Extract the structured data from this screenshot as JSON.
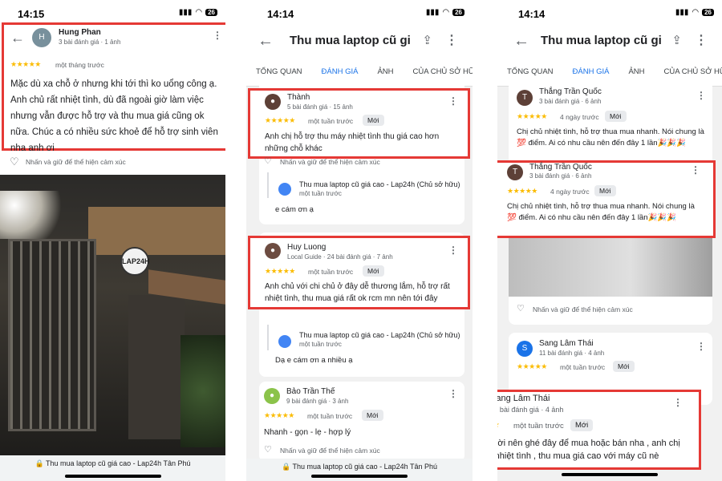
{
  "status": {
    "time_1": "14:15",
    "time_2": "14:14",
    "time_3": "14:14",
    "battery": "26"
  },
  "common": {
    "app_title": "Thu mua laptop cũ giá c...",
    "app_title_3": "Thu mua laptop cũ giá ...",
    "tabs": [
      "TỔNG QUAN",
      "ĐÁNH GIÁ",
      "ẢNH",
      "CỦA CHỦ SỞ HỮU"
    ],
    "react_hint": "Nhấn và giữ để thể hiện cảm xúc",
    "new_badge": "Mới",
    "owner_name": "Thu mua laptop cũ giá cao - Lap24h (Chủ sở hữu)",
    "owner_time": "một tuần trước",
    "stars": "★★★★★",
    "bottom_url": "Thu mua laptop cũ giá cao - Lap24h Tân Phú"
  },
  "phone1": {
    "reviewer": {
      "initial": "H",
      "name": "Hung Phan",
      "meta": "3 bài đánh giá · 1 ảnh",
      "time": "một tháng trước",
      "text": "Mặc dù xa chỗ ở nhưng khi tới thì ko uổng công ạ. Anh chủ rất nhiệt tình, dù đã ngoài giờ làm việc nhưng vẫn được hỗ trợ và thu mua giá cũng ok nữa. Chúc a có nhiều sức khoẻ để hỗ trợ sinh viên nha anh ơi"
    },
    "shop_sign": "LAP24H"
  },
  "phone2": {
    "reviews": [
      {
        "name": "Thành",
        "meta": "5 bài đánh giá · 15 ảnh",
        "time": "một tuần trước",
        "text": "Anh chị hỗ trợ thu máy nhiệt tình thu giá cao hơn những chỗ khác",
        "reply": "e cám ơn ạ"
      },
      {
        "name": "Huy Luong",
        "meta": "Local Guide · 24 bài đánh giá · 7 ảnh",
        "time": "một tuần trước",
        "text": "Anh chủ với chi chủ ở đây dễ thương lắm, hỗ trợ rất nhiệt tình, thu mua giá rất ok rcm mn nên tới đây",
        "reply": "Dạ e cám ơn a nhiều ạ"
      },
      {
        "name": "Bảo Trần Thế",
        "meta": "9 bài đánh giá · 3 ảnh",
        "time": "một tuần trước",
        "text": "Nhanh - gọn - lẹ - hợp lý"
      }
    ]
  },
  "phone3": {
    "reviews": [
      {
        "initial": "T",
        "name": "Thắng Trần Quốc",
        "meta": "3 bài đánh giá · 6 ảnh",
        "time": "4 ngày trước",
        "text": "Chị chủ nhiệt tình, hỗ trợ thua mua nhanh. Nói chung là 💯 điểm. Ai có nhu cầu nên đến đây 1 lần🎉🎉🎉"
      },
      {
        "initial": "S",
        "name": "Sang Lâm Thái",
        "meta": "11 bài đánh giá · 4 ảnh",
        "time": "một tuần trước",
        "text": "Mọi người nên ghé đây để mua hoặc bán nha , anh chị chủ rất nhiệt tình , thu mua giá cao với máy cũ nè"
      }
    ]
  }
}
